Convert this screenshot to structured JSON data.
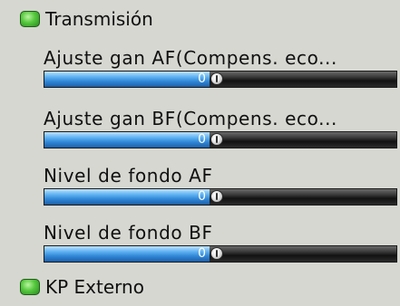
{
  "section_top": {
    "title": "Transmisión",
    "led_color": "#55c83d"
  },
  "section_bottom": {
    "title": "KP Externo",
    "led_color": "#55c83d"
  },
  "items": [
    {
      "label": "Ajuste gan AF(Compens. eco...",
      "value": "0",
      "level_percent": 47
    },
    {
      "label": "Ajuste gan BF(Compens. eco...",
      "value": "0",
      "level_percent": 47
    },
    {
      "label": "Nivel de fondo AF",
      "value": "0",
      "level_percent": 47
    },
    {
      "label": "Nivel de fondo BF",
      "value": "0",
      "level_percent": 47
    }
  ],
  "colors": {
    "background": "#d6d7d1",
    "slider_fill": "#2f86d6",
    "slider_track": "#121212"
  }
}
